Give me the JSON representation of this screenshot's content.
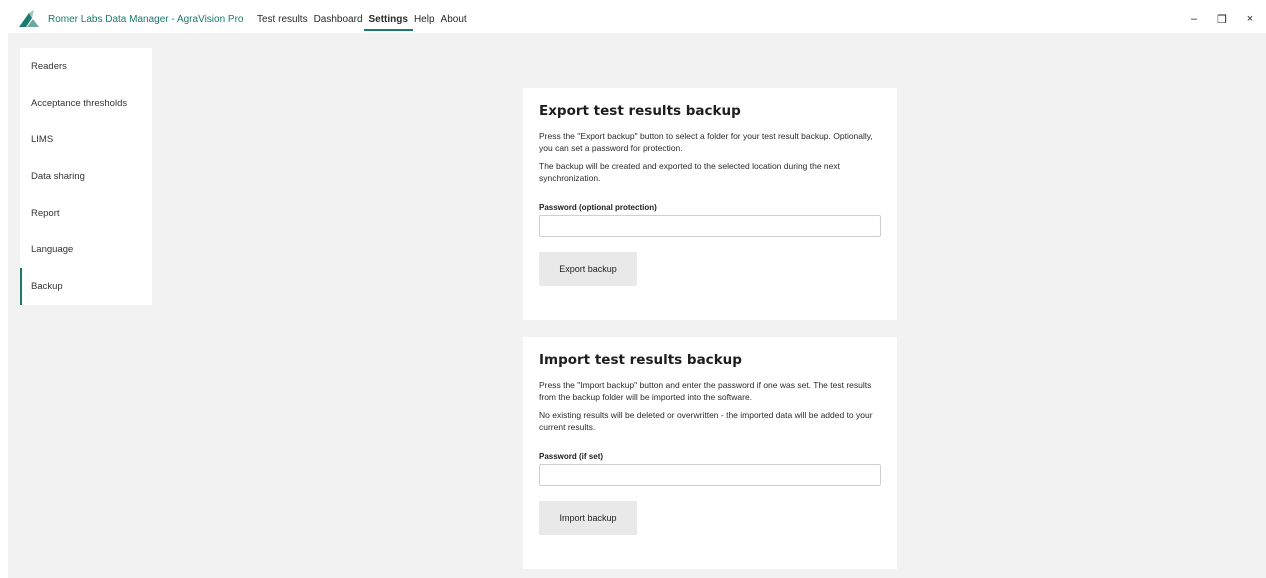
{
  "app": {
    "title": "Romer Labs Data Manager - AgraVision Pro",
    "brand_color": "#1b7a6e"
  },
  "menu": {
    "items": [
      {
        "label": "Test results",
        "active": false
      },
      {
        "label": "Dashboard",
        "active": false
      },
      {
        "label": "Settings",
        "active": true
      },
      {
        "label": "Help",
        "active": false
      },
      {
        "label": "About",
        "active": false
      }
    ]
  },
  "window_controls": {
    "minimize": "–",
    "restore": "❐",
    "close": "×"
  },
  "sidebar": {
    "items": [
      {
        "label": "Readers",
        "active": false
      },
      {
        "label": "Acceptance thresholds",
        "active": false
      },
      {
        "label": "LIMS",
        "active": false
      },
      {
        "label": "Data sharing",
        "active": false
      },
      {
        "label": "Report",
        "active": false
      },
      {
        "label": "Language",
        "active": false
      },
      {
        "label": "Backup",
        "active": true
      }
    ]
  },
  "export": {
    "title": "Export test results backup",
    "paragraph1": "Press the \"Export backup\" button to select a folder for your test result backup. Optionally, you can set a password for protection.",
    "paragraph2": "The backup will be created and exported to the selected location during the next synchronization.",
    "password_label": "Password (optional protection)",
    "password_value": "",
    "button_label": "Export backup"
  },
  "import": {
    "title": "Import test results backup",
    "paragraph1": "Press the \"Import backup\" button and enter the password if one was set. The test results from the backup folder will be imported into the software.",
    "paragraph2": "No existing results will be deleted or overwritten - the imported data will be added to your current results.",
    "password_label": "Password (if set)",
    "password_value": "",
    "button_label": "Import backup"
  }
}
